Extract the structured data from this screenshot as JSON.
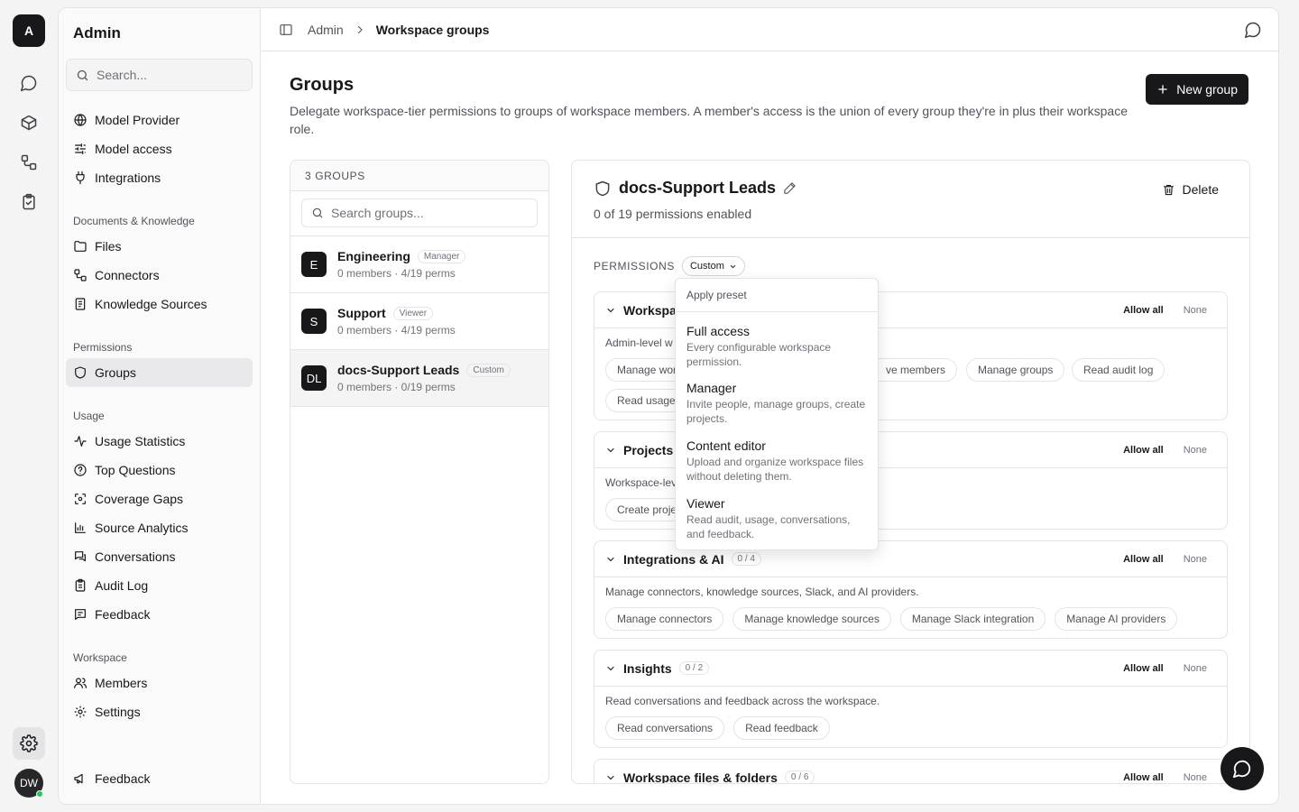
{
  "rail": {
    "logo": "A",
    "avatar": "DW"
  },
  "sidebar": {
    "title": "Admin",
    "search_placeholder": "Search...",
    "items_top": [
      {
        "label": "Model Provider",
        "icon": "globe-icon"
      },
      {
        "label": "Model access",
        "icon": "sliders-icon"
      },
      {
        "label": "Integrations",
        "icon": "plug-icon"
      }
    ],
    "sections": {
      "docs": "Documents & Knowledge",
      "permissions": "Permissions",
      "usage": "Usage",
      "workspace": "Workspace"
    },
    "docs_items": [
      {
        "label": "Files",
        "icon": "folder-icon"
      },
      {
        "label": "Connectors",
        "icon": "connector-icon"
      },
      {
        "label": "Knowledge Sources",
        "icon": "book-icon"
      }
    ],
    "permissions_items": [
      {
        "label": "Groups",
        "icon": "shield-icon"
      }
    ],
    "usage_items": [
      {
        "label": "Usage Statistics",
        "icon": "activity-icon"
      },
      {
        "label": "Top Questions",
        "icon": "question-icon"
      },
      {
        "label": "Coverage Gaps",
        "icon": "scan-icon"
      },
      {
        "label": "Source Analytics",
        "icon": "bar-chart-icon"
      },
      {
        "label": "Conversations",
        "icon": "chat-icon"
      },
      {
        "label": "Audit Log",
        "icon": "clipboard-icon"
      },
      {
        "label": "Feedback",
        "icon": "message-square-icon"
      }
    ],
    "workspace_items": [
      {
        "label": "Members",
        "icon": "users-icon"
      },
      {
        "label": "Settings",
        "icon": "gear-icon"
      }
    ],
    "footer_feedback": "Feedback"
  },
  "breadcrumb": {
    "root": "Admin",
    "current": "Workspace groups"
  },
  "page": {
    "title": "Groups",
    "description": "Delegate workspace-tier permissions to groups of workspace members. A member's access is the union of every group they're in plus their workspace role.",
    "new_button": "New group"
  },
  "groups": {
    "count_label": "3 GROUPS",
    "search_placeholder": "Search groups...",
    "items": [
      {
        "initials": "E",
        "name": "Engineering",
        "badge": "Manager",
        "sub": "0 members · 4/19 perms"
      },
      {
        "initials": "S",
        "name": "Support",
        "badge": "Viewer",
        "sub": "0 members · 4/19 perms"
      },
      {
        "initials": "DL",
        "name": "docs-Support Leads",
        "badge": "Custom",
        "sub": "0 members · 0/19 perms"
      }
    ]
  },
  "detail": {
    "title": "docs-Support Leads",
    "subtitle": "0 of 19 permissions enabled",
    "delete_label": "Delete",
    "permissions_label": "PERMISSIONS",
    "preset_value": "Custom",
    "allow_all": "Allow all",
    "none": "None",
    "cards": [
      {
        "title": "Workspa",
        "count": "",
        "desc": "Admin-level w",
        "chips": [
          "Manage wor",
          "ve members",
          "Manage groups",
          "Read audit log",
          "Read usage"
        ]
      },
      {
        "title": "Projects",
        "count": "",
        "desc": "Workspace-lev",
        "chips": [
          "Create proje"
        ]
      },
      {
        "title": "Integrations & AI",
        "count": "0 / 4",
        "desc": "Manage connectors, knowledge sources, Slack, and AI providers.",
        "chips": [
          "Manage connectors",
          "Manage knowledge sources",
          "Manage Slack integration",
          "Manage AI providers"
        ]
      },
      {
        "title": "Insights",
        "count": "0 / 2",
        "desc": "Read conversations and feedback across the workspace.",
        "chips": [
          "Read conversations",
          "Read feedback"
        ]
      },
      {
        "title": "Workspace files & folders",
        "count": "0 / 6",
        "desc": "",
        "chips": []
      }
    ]
  },
  "preset_menu": {
    "header": "Apply preset",
    "options": [
      {
        "title": "Full access",
        "desc": "Every configurable workspace permission."
      },
      {
        "title": "Manager",
        "desc": "Invite people, manage groups, create projects."
      },
      {
        "title": "Content editor",
        "desc": "Upload and organize workspace files without deleting them."
      },
      {
        "title": "Viewer",
        "desc": "Read audit, usage, conversations, and feedback."
      }
    ]
  }
}
